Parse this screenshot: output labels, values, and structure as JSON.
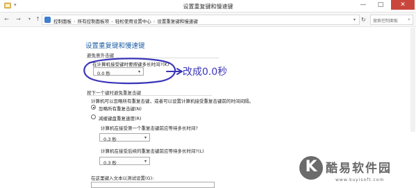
{
  "window": {
    "title": "设置重复键和慢速键",
    "min_glyph": "—",
    "max_glyph": "□",
    "close_glyph": "✕"
  },
  "nav": {
    "back_glyph": "←",
    "forward_glyph": "→",
    "dropdown_glyph": "▾",
    "up_glyph": "↑"
  },
  "address": {
    "crumbs": [
      "控制面板",
      "所有控制面板项",
      "轻松使用设置中心",
      "设置重复键和慢速键"
    ],
    "separator": "›",
    "dropdown_glyph": "▾",
    "refresh_glyph": "↻"
  },
  "search": {
    "placeholder": "搜索控制面板",
    "icon": "search-icon"
  },
  "page": {
    "title": "设置重复键和慢速键"
  },
  "group1": {
    "label": "避免意外击键",
    "question": "在计算机接受键时要按键多长时间?(K)",
    "select_value": "0.0 秒"
  },
  "annotation": {
    "text": "改成0.0秒",
    "color": "#3a35b8"
  },
  "group2": {
    "label": "按下一个键时避免重复击键",
    "description": "计算机可以忽略所有重复击键，或者可以设置计算机接受重复击键前的时间间隔。",
    "radio_ignore": "忽略所有重复击键(N)",
    "radio_slow": "减缓键盘重复速度(R)",
    "first_question": "计算机在接受第一个重复击键前应等待多长时间?",
    "first_value": "0.3 秒",
    "later_question": "计算机在接受后续的重复击键前应等待多长时间?(L)",
    "later_value": "0.3 秒",
    "test_label": "在这里键入文本以测试设置(G):"
  },
  "watermark": {
    "glyph": "K",
    "name": "酷易软件园",
    "url": "www.kuyisoft.com"
  },
  "colors": {
    "accent": "#1d5ea5",
    "close_button": "#c9463d"
  }
}
